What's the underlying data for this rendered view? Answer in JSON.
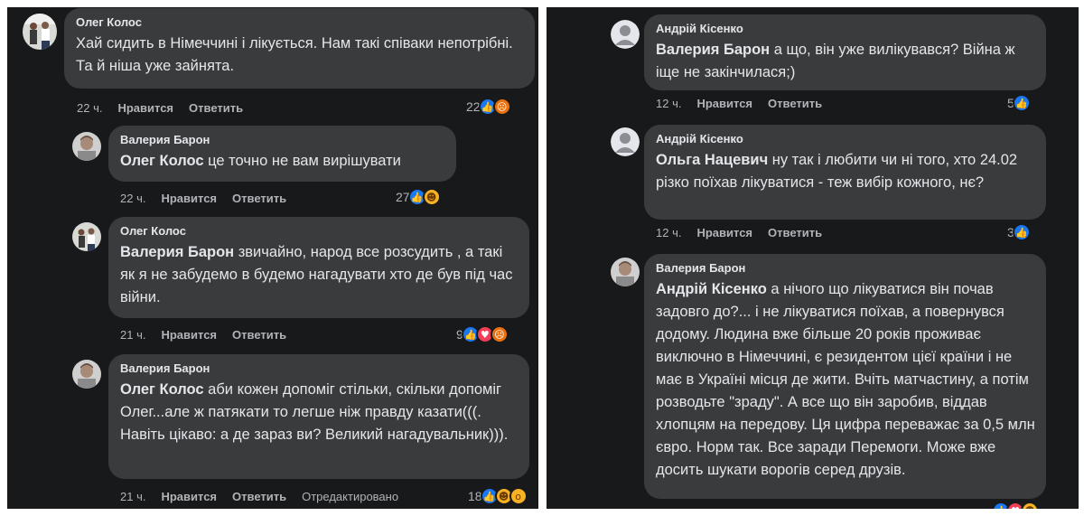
{
  "left": {
    "comments": [
      {
        "author": "Олег Колос",
        "text": "Хай сидить в Німеччині і лікується. Нам такі співаки непотрібні. Та й ніша уже зайнята.",
        "time": "22 ч.",
        "like": "Нравится",
        "reply": "Ответить",
        "count": "22",
        "reactions": [
          "like-icon",
          "angry-icon"
        ]
      },
      {
        "author": "Валерия Барон",
        "mention": "Олег Колос",
        "text": " це точно не вам вирішувати",
        "time": "22 ч.",
        "like": "Нравится",
        "reply": "Ответить",
        "count": "27",
        "reactions": [
          "like-icon",
          "haha-icon"
        ]
      },
      {
        "author": "Олег Колос",
        "mention": "Валерия Барон",
        "text": " звичайно, народ все розсудить , а такі як я не забудемо в будемо нагадувати хто де був під час війни.",
        "time": "21 ч.",
        "like": "Нравится",
        "reply": "Ответить",
        "count": "9",
        "reactions": [
          "like-icon",
          "love-icon",
          "angry-icon"
        ]
      },
      {
        "author": "Валерия Барон",
        "mention": "Олег Колос",
        "text": " аби кожен допоміг стільки, скільки допоміг Олег...але ж патякати то легше ніж правду казати(((. Навіть цікаво: а де зараз ви? Великий нагадувальник))).",
        "time": "21 ч.",
        "like": "Нравится",
        "reply": "Ответить",
        "edited": "Отредактировано",
        "count": "18",
        "reactions": [
          "like-icon",
          "haha-icon",
          "wow-icon"
        ]
      }
    ]
  },
  "right": {
    "comments": [
      {
        "author": "Андрій Кісенко",
        "mention": "Валерия Барон",
        "text": " а що, він уже вилікувався? Війна ж іще не закінчилася;)",
        "time": "12 ч.",
        "like": "Нравится",
        "reply": "Ответить",
        "count": "5",
        "reactions": [
          "like-icon"
        ]
      },
      {
        "author": "Андрій Кісенко",
        "mention": "Ольга Нацевич",
        "text": " ну так і любити чи ні того, хто 24.02 різко поїхав лікуватися - теж вибір кожного, нє?",
        "time": "12 ч.",
        "like": "Нравится",
        "reply": "Ответить",
        "count": "3",
        "reactions": [
          "like-icon"
        ]
      },
      {
        "author": "Валерия Барон",
        "mention": "Андрій Кісенко",
        "text": " а нічого що лікуватися він почав задовго до?... і не лікуватися поїхав, а повернувся додому. Людина вже більше 20 років проживає виключно в Німеччині, є резидентом цієї країни і не має в Україні місця де жити. Вчіть матчастину, а потім розводьте \"зраду\". А все що він заробив, віддав хлопцям на передову. Ця цифра переважає за 0,5 млн євро. Норм так. Все заради Перемоги. Може вже досить шукати ворогів серед друзів.",
        "reactions": [
          "like-icon",
          "love-icon",
          "haha-icon"
        ]
      }
    ]
  },
  "colors": {
    "background": "#18191a",
    "bubble": "#3a3b3c",
    "text": "#e4e6eb",
    "secondary": "#b0b3b8",
    "like": "#1877f2"
  }
}
